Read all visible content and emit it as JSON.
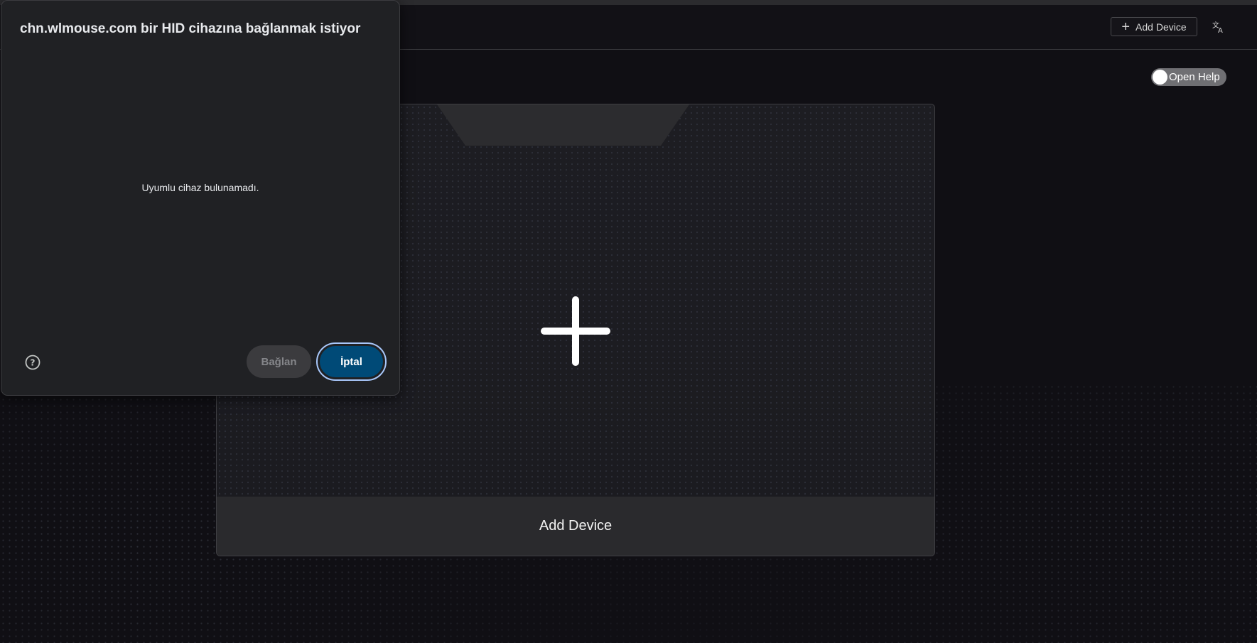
{
  "header": {
    "add_device_label": "Add Device",
    "add_icon": "plus-icon",
    "translate_icon": "translate-icon"
  },
  "help_toggle": {
    "label": "Open Help",
    "checked": false
  },
  "device_card": {
    "plus_icon": "plus-icon",
    "label": "Add Device"
  },
  "dialog": {
    "title": "chn.wlmouse.com bir HID cihazına bağlanmak istiyor",
    "empty_message": "Uyumlu cihaz bulunamadı.",
    "help_icon": "help-circle-icon",
    "connect_label": "Bağlan",
    "cancel_label": "İptal"
  },
  "colors": {
    "background": "#100f14",
    "card_footer": "#2a2a2d",
    "dialog_bg": "#202124",
    "cancel_bg": "#004a77",
    "cancel_ring": "#a8c7fa"
  }
}
